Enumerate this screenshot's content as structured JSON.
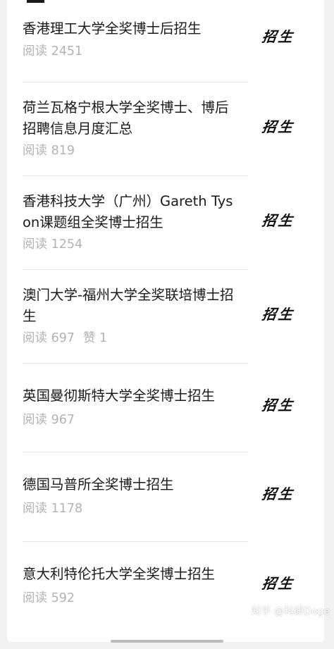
{
  "articles": [
    {
      "title": "香港理工大学全奖博士后招生",
      "reads": "阅读 2451",
      "likes": "",
      "stamp": "招生"
    },
    {
      "title": "荷兰瓦格宁根大学全奖博士、博后招聘信息月度汇总",
      "reads": "阅读 819",
      "likes": "",
      "stamp": "招生"
    },
    {
      "title": "香港科技大学（广州）Gareth Tyson课题组全奖博士招生",
      "reads": "阅读 1254",
      "likes": "",
      "stamp": "招生"
    },
    {
      "title": "澳门大学-福州大学全奖联培博士招生",
      "reads": "阅读 697",
      "likes": "赞 1",
      "stamp": "招生"
    },
    {
      "title": "英国曼彻斯特大学全奖博士招生",
      "reads": "阅读 967",
      "likes": "",
      "stamp": "招生"
    },
    {
      "title": "德国马普所全奖博士招生",
      "reads": "阅读 1178",
      "likes": "",
      "stamp": "招生"
    },
    {
      "title": "意大利特伦托大学全奖博士招生",
      "reads": "阅读 592",
      "likes": "",
      "stamp": "招生"
    }
  ],
  "watermark": "知乎 @科研Doge",
  "colors": {
    "title": "#1a1a1a",
    "meta": "#b3b3b3",
    "background": "#f2f2f2",
    "card": "#ffffff"
  }
}
